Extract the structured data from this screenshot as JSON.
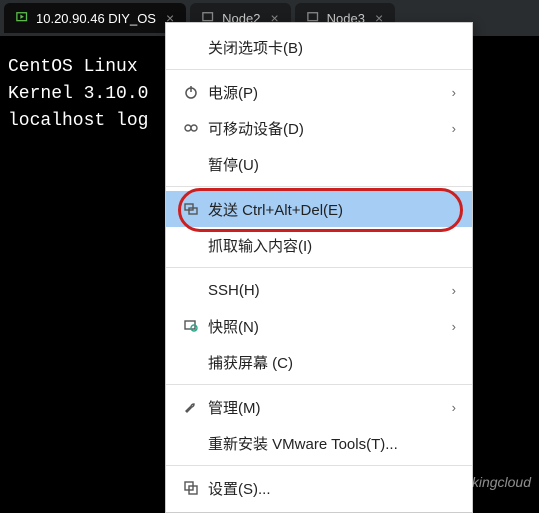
{
  "tabs": [
    {
      "label": "10.20.90.46 DIY_OS",
      "active": true
    },
    {
      "label": "Node2",
      "active": false
    },
    {
      "label": "Node3",
      "active": false
    }
  ],
  "terminal": {
    "line1": "CentOS Linux ",
    "line2": "Kernel 3.10.0",
    "line3": "",
    "line4": "localhost log"
  },
  "menu": {
    "close_tab": "关闭选项卡(B)",
    "power": "电源(P)",
    "removable": "可移动设备(D)",
    "pause": "暂停(U)",
    "send_cad": "发送 Ctrl+Alt+Del(E)",
    "grab_input": "抓取输入内容(I)",
    "ssh": "SSH(H)",
    "snapshot": "快照(N)",
    "capture": "捕获屏幕 (C)",
    "manage": "管理(M)",
    "reinstall": "重新安装 VMware Tools(T)...",
    "settings": "设置(S)..."
  },
  "watermark": "头条@walkingcloud"
}
